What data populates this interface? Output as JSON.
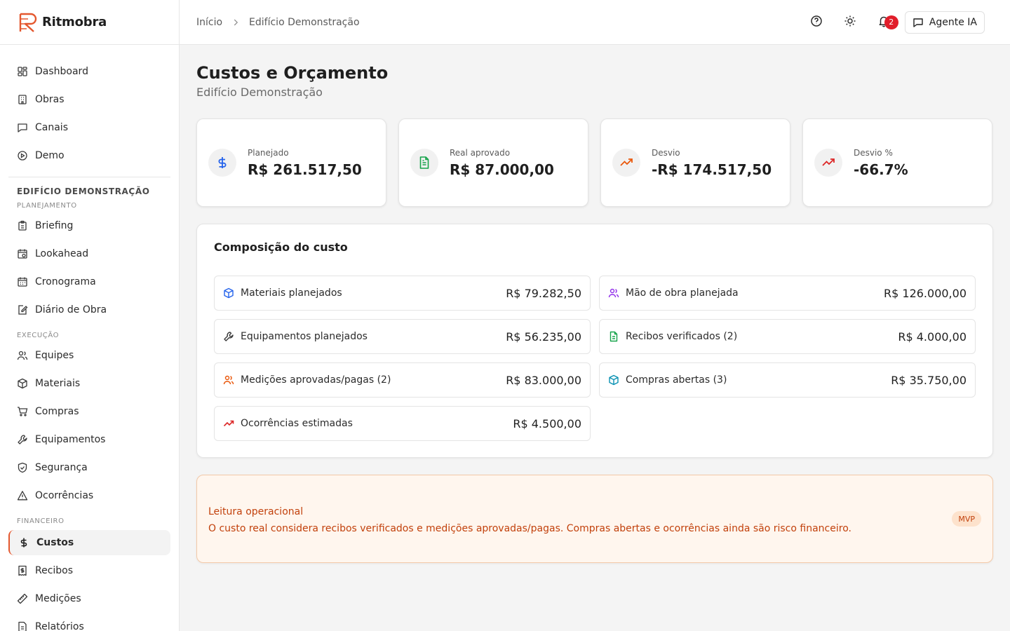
{
  "app": {
    "name": "Ritmobra",
    "brand_color": "#e4572e"
  },
  "sidebar": {
    "main_items": [
      {
        "label": "Dashboard",
        "icon": "dashboard-icon"
      },
      {
        "label": "Obras",
        "icon": "building-icon"
      },
      {
        "label": "Canais",
        "icon": "message-icon"
      },
      {
        "label": "Demo",
        "icon": "play-icon"
      }
    ],
    "project_title": "EDIFÍCIO DEMONSTRAÇÃO",
    "groups": {
      "planejamento": "PLANEJAMENTO",
      "execucao": "EXECUÇÃO",
      "financeiro": "FINANCEIRO"
    },
    "planejamento_items": [
      {
        "label": "Briefing",
        "icon": "clipboard-icon"
      },
      {
        "label": "Lookahead",
        "icon": "calendar-clock-icon"
      },
      {
        "label": "Cronograma",
        "icon": "calendar-icon"
      },
      {
        "label": "Diário de Obra",
        "icon": "edit-note-icon"
      }
    ],
    "execucao_items": [
      {
        "label": "Equipes",
        "icon": "users-icon"
      },
      {
        "label": "Materiais",
        "icon": "package-icon"
      },
      {
        "label": "Compras",
        "icon": "cart-icon"
      },
      {
        "label": "Equipamentos",
        "icon": "wrench-icon"
      },
      {
        "label": "Segurança",
        "icon": "shield-icon"
      },
      {
        "label": "Ocorrências",
        "icon": "warning-icon"
      }
    ],
    "financeiro_items": [
      {
        "label": "Custos",
        "icon": "dollar-icon",
        "active": true
      },
      {
        "label": "Recibos",
        "icon": "receipt-icon"
      },
      {
        "label": "Medições",
        "icon": "ruler-icon"
      },
      {
        "label": "Relatórios",
        "icon": "report-icon"
      }
    ]
  },
  "header": {
    "breadcrumb": [
      "Início",
      "Edifício Demonstração"
    ],
    "notifications_count": "2",
    "agent_button": "Agente IA"
  },
  "page": {
    "title": "Custos e Orçamento",
    "subtitle": "Edifício Demonstração"
  },
  "stats": [
    {
      "label": "Planejado",
      "value": "R$ 261.517,50",
      "icon": "dollar-icon",
      "color": "#2563eb"
    },
    {
      "label": "Real aprovado",
      "value": "R$ 87.000,00",
      "icon": "file-text-icon",
      "color": "#16a34a"
    },
    {
      "label": "Desvio",
      "value": "-R$ 174.517,50",
      "icon": "trending-up-icon",
      "color": "#ea580c"
    },
    {
      "label": "Desvio %",
      "value": "-66.7%",
      "icon": "trending-up-icon",
      "color": "#dc2626"
    }
  ],
  "composition": {
    "title": "Composição do custo",
    "rows": [
      {
        "label": "Materiais planejados",
        "value": "R$ 79.282,50",
        "icon": "package-icon",
        "color": "#2563eb"
      },
      {
        "label": "Mão de obra planejada",
        "value": "R$ 126.000,00",
        "icon": "users-icon",
        "color": "#9333ea"
      },
      {
        "label": "Equipamentos planejados",
        "value": "R$ 56.235,00",
        "icon": "wrench-icon",
        "color": "#3a3a3a"
      },
      {
        "label": "Recibos verificados (2)",
        "value": "R$ 4.000,00",
        "icon": "file-text-icon",
        "color": "#16a34a"
      },
      {
        "label": "Medições aprovadas/pagas (2)",
        "value": "R$ 83.000,00",
        "icon": "users-icon",
        "color": "#ea580c"
      },
      {
        "label": "Compras abertas (3)",
        "value": "R$ 35.750,00",
        "icon": "package-icon",
        "color": "#0891b2"
      },
      {
        "label": "Ocorrências estimadas",
        "value": "R$ 4.500,00",
        "icon": "trending-up-icon",
        "color": "#dc2626"
      }
    ]
  },
  "alert": {
    "title": "Leitura operacional",
    "text": "O custo real considera recibos verificados e medições aprovadas/pagas. Compras abertas e ocorrências ainda são risco financeiro.",
    "badge": "MVP",
    "color": "#c2410c"
  }
}
